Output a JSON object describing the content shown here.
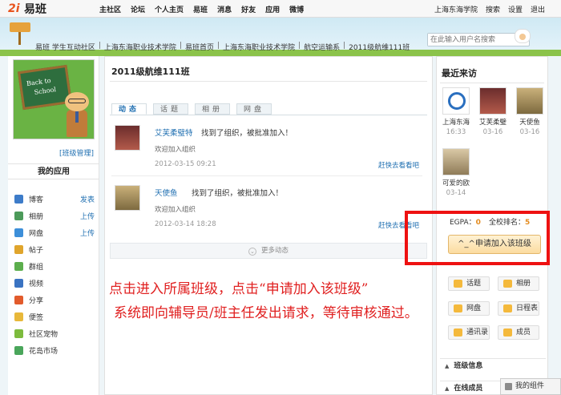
{
  "brand": {
    "name": "易班"
  },
  "topnav": {
    "items": [
      "主社区",
      "论坛",
      "个人主页",
      "易班",
      "消息",
      "好友",
      "应用",
      "微博"
    ],
    "right": [
      "上海东海学院",
      "搜索",
      "设置",
      "退出"
    ]
  },
  "breadcrumb": [
    "易班 学生互动社区",
    "上海东海职业技术学院",
    "易班首页",
    "上海东海职业技术学院",
    "航空运输系",
    "2011级航维111班"
  ],
  "search": {
    "placeholder": "在此输入用户名搜索"
  },
  "left": {
    "avatar_text_1": "Back to",
    "avatar_text_2": "School",
    "manage_label": "[班级管理]",
    "myapps_title": "我的应用",
    "apps": [
      {
        "label": "博客",
        "action": "发表",
        "color": "#3d7cc9"
      },
      {
        "label": "相册",
        "action": "上传",
        "color": "#4c9a5a"
      },
      {
        "label": "网盘",
        "action": "上传",
        "color": "#3d8fd9"
      },
      {
        "label": "帖子",
        "action": "",
        "color": "#e0a52c"
      },
      {
        "label": "群组",
        "action": "",
        "color": "#5cae4d"
      },
      {
        "label": "视频",
        "action": "",
        "color": "#3a73c2"
      },
      {
        "label": "分享",
        "action": "",
        "color": "#e25b2c"
      },
      {
        "label": "便签",
        "action": "",
        "color": "#e8b83a"
      },
      {
        "label": "社区宠物",
        "action": "",
        "color": "#7dbb3d"
      },
      {
        "label": "花岛市场",
        "action": "",
        "color": "#4aa65b"
      }
    ]
  },
  "main": {
    "title": "2011级航维111班",
    "tabs": [
      "动态",
      "话题",
      "相册",
      "网盘"
    ],
    "feed": [
      {
        "name": "艾芙柔璧特",
        "action": "找到了组织，被批准加入！",
        "sub": "欢迎加入组织",
        "time": "2012-03-15 09:21",
        "link": "赶快去看看吧"
      },
      {
        "name": "天使鱼",
        "action": "找到了组织，被批准加入！",
        "sub": "欢迎加入组织",
        "time": "2012-03-14 18:28",
        "link": "赶快去看看吧"
      }
    ],
    "more_label": "更多动态"
  },
  "right": {
    "visitors_title": "最近来访",
    "visitors": [
      {
        "name": "上海东海",
        "date": "16:33"
      },
      {
        "name": "艾芙柔璧",
        "date": "03-16"
      },
      {
        "name": "天使鱼",
        "date": "03-16"
      },
      {
        "name": "可爱的欧",
        "date": "03-14"
      }
    ],
    "egpa_label": "EGPA：",
    "egpa_value": "0",
    "rank_label": "全校排名：",
    "rank_value": "5",
    "join_label": "^_^申请加入该班级",
    "quick": [
      "话题",
      "相册",
      "网盘",
      "日程表",
      "通讯录",
      "成员"
    ],
    "panel_info": "班级信息",
    "panel_online": "在线成员"
  },
  "annotation": {
    "line1": "点击进入所属班级，点击“申请加入该班级”",
    "line2": "系统即向辅导员/班主任发出请求，等待审核通过。"
  },
  "widget_label": "我的组件"
}
